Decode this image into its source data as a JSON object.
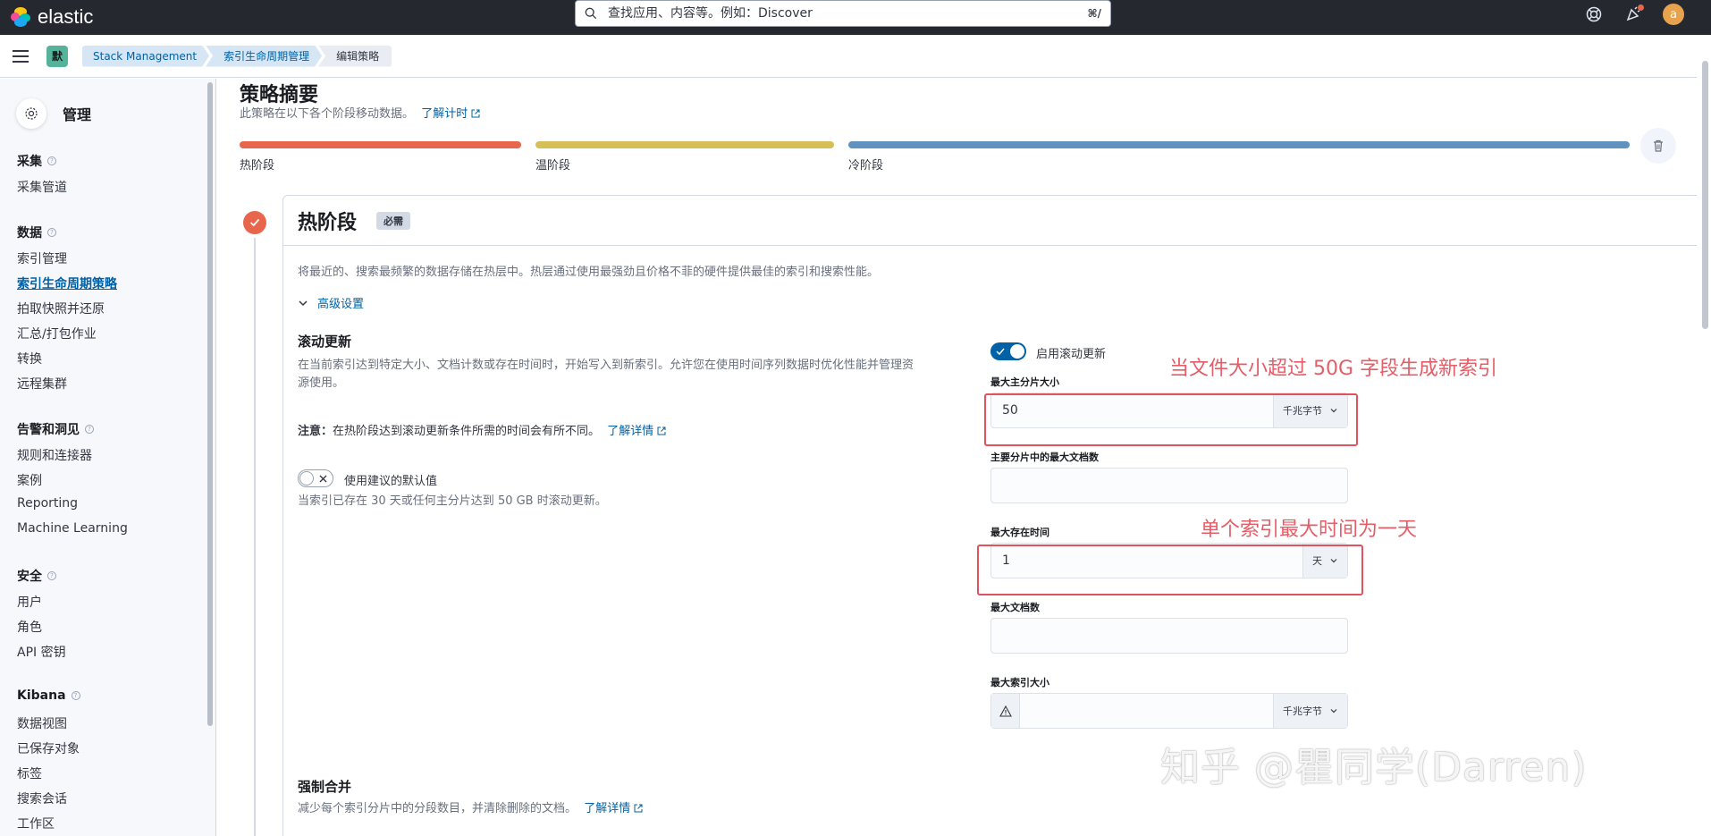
{
  "header": {
    "logo_text": "elastic",
    "search_placeholder": "查找应用、内容等。例如：Discover",
    "search_shortcut": "⌘/",
    "avatar_letter": "a"
  },
  "breadcrumbs": {
    "space": "默",
    "items": [
      "Stack Management",
      "索引生命周期管理",
      "编辑策略"
    ]
  },
  "sidebar": {
    "title": "管理",
    "sections": [
      {
        "title": "采集",
        "items": [
          "采集管道"
        ]
      },
      {
        "title": "数据",
        "items": [
          "索引管理",
          "索引生命周期策略",
          "拍取快照并还原",
          "汇总/打包作业",
          "转换",
          "远程集群"
        ]
      },
      {
        "title": "告警和洞见",
        "items": [
          "规则和连接器",
          "案例",
          "Reporting",
          "Machine Learning"
        ]
      },
      {
        "title": "安全",
        "items": [
          "用户",
          "角色",
          "API 密钥"
        ]
      },
      {
        "title": "Kibana",
        "items": [
          "数据视图",
          "已保存对象",
          "标签",
          "搜索会话",
          "工作区"
        ]
      }
    ],
    "active_item": "索引生命周期策略"
  },
  "summary": {
    "title": "策略摘要",
    "subtitle": "此策略在以下各个阶段移动数据。",
    "link": "了解计时",
    "phases": [
      {
        "label": "热阶段",
        "color": "#e7664c"
      },
      {
        "label": "温阶段",
        "color": "#d6bf57"
      },
      {
        "label": "冷阶段",
        "color": "#6092c0"
      }
    ]
  },
  "hot_phase": {
    "title": "热阶段",
    "badge": "必需",
    "description": "将最近的、搜索最频繁的数据存储在热层中。热层通过使用最强劲且价格不菲的硬件提供最佳的索引和搜索性能。",
    "advanced_link": "高级设置",
    "rollover": {
      "title": "滚动更新",
      "description_line1": "在当前索引达到特定大小、文档计数或存在时间时，开始写入到新索引。允许您在使用时间序列数据时优化性能并管理资",
      "description_line2": "源使用。",
      "note_prefix": "注意：",
      "note_text": "在热阶段达到滚动更新条件所需的时间会有所不同。",
      "note_link": "了解详情",
      "defaults_toggle_label": "使用建议的默认值",
      "defaults_desc": "当索引已存在 30 天或任何主分片达到 50 GB 时滚动更新。",
      "enable_label": "启用滚动更新",
      "enable_on": true,
      "defaults_on": false,
      "fields": {
        "max_primary_shard_size": {
          "label": "最大主分片大小",
          "value": "50",
          "unit": "千兆字节"
        },
        "max_primary_shard_docs": {
          "label": "主要分片中的最大文档数",
          "value": ""
        },
        "max_age": {
          "label": "最大存在时间",
          "value": "1",
          "unit": "天"
        },
        "max_docs": {
          "label": "最大文档数",
          "value": ""
        },
        "max_index_size": {
          "label": "最大索引大小",
          "value": "",
          "unit": "千兆字节"
        }
      }
    },
    "forcemerge": {
      "title": "强制合并",
      "description": "减少每个索引分片中的分段数目，并清除删除的文档。",
      "link": "了解详情"
    }
  },
  "annotations": {
    "shard_size_note": "当文件大小超过 50G 字段生成新索引",
    "max_age_note": "单个索引最大时间为一天",
    "watermark": "知乎 @瞿同学(Darren)"
  }
}
